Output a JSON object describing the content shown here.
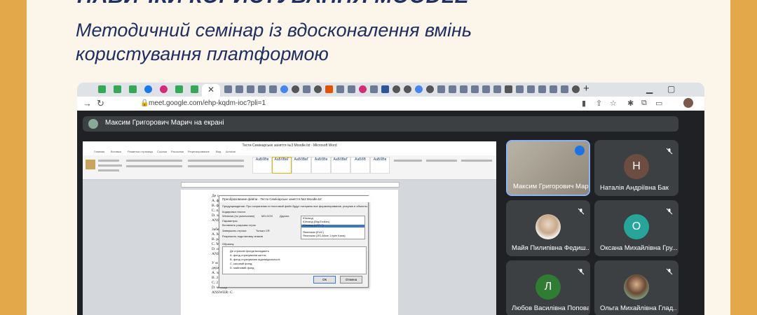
{
  "header": {
    "title": "НАВИЧКИ КОРИСТУВАННЯ MOODLE",
    "subtitle_lines": [
      "Методичний семінар із вдосконалення вмінь",
      "користування платформою"
    ]
  },
  "browser": {
    "url": "meet.google.com/ehp-kqdm-ioc?pli=1",
    "new_tab": "+"
  },
  "meet": {
    "presenter_banner": "Максим Григорович Марич на екрані",
    "participants": [
      {
        "name": "Максим Григорович Мар...",
        "type": "video"
      },
      {
        "name": "Наталія Андріївна Бак",
        "initial": "Н",
        "color": "#6d4c41"
      },
      {
        "name": "Майя Пилипівна Федиш...",
        "type": "photo"
      },
      {
        "name": "Оксана Михайлівна Гру...",
        "initial": "О",
        "color": "#26a69a"
      },
      {
        "name": "Любов Василівна Попова",
        "initial": "Л",
        "color": "#2e7d32"
      },
      {
        "name": "Ольга Михайлівна Глад...",
        "type": "photo"
      }
    ]
  },
  "word": {
    "window_title": "Тести Семінарське заняття №3 Moodle.txt - Microsoft Word",
    "file_tab": "Файл",
    "tabs": [
      "Главная",
      "Вставка",
      "Разметка страницы",
      "Ссылки",
      "Рассылки",
      "Рецензирование",
      "Вид",
      "Acrobat"
    ],
    "styles": [
      "АаБбВв",
      "АаБбВвГ",
      "АаБбВвГ",
      "АаБбВв",
      "АаБбВвГ",
      "АаБбВ",
      "АаБбВв"
    ],
    "page_lines": [
      "Де с",
      "A. фо",
      "B. фо",
      "C. пл",
      "D. за",
      "ANSV",
      "Забе",
      "A. М",
      "B. ра",
      "C. М",
      "D. со",
      "ANSV",
      "У м",
      "держ",
      "A. за",
      "B. 3 тижні;",
      "C. 2 тижні;",
      "D. місяць",
      "ANSWER: C"
    ],
    "dialog": {
      "title": "Преобразование файла - Тести Семінарське заняття №3 Moodle.txt",
      "warning": "Предупреждение: При сохранении в текстовый файл будут потеряны все форматирование, рисунки и объекты.",
      "encoding_label": "Кодировка текста:",
      "options": [
        "Windows (по умолчанию)",
        "MS-DOS",
        "Другая:"
      ],
      "params_label": "Параметры:",
      "insert_breaks": "Вставлять разрывы строк",
      "end_lines": "Завершать строки:",
      "end_value": "Только CR",
      "allow_sub": "Разрешить подстановку знаков",
      "preview_label": "Образец:",
      "preview_lines": [
        "Де страхові фонди вкладають",
        "A. фонд страхування життя;",
        "B. фонд страхування відповідальності;",
        "C. касовий фонд;",
        "D. майновий фонд"
      ],
      "list_items": [
        "Юникод",
        "Юникод (Big-Endian)",
        "Юникод (UTF-7)",
        "Юникод (UTF-8)",
        "Японская (EUC)",
        "Японская (JIS-Allow 1 byte Kana)"
      ],
      "ok": "ОК",
      "cancel": "Отмена"
    }
  }
}
